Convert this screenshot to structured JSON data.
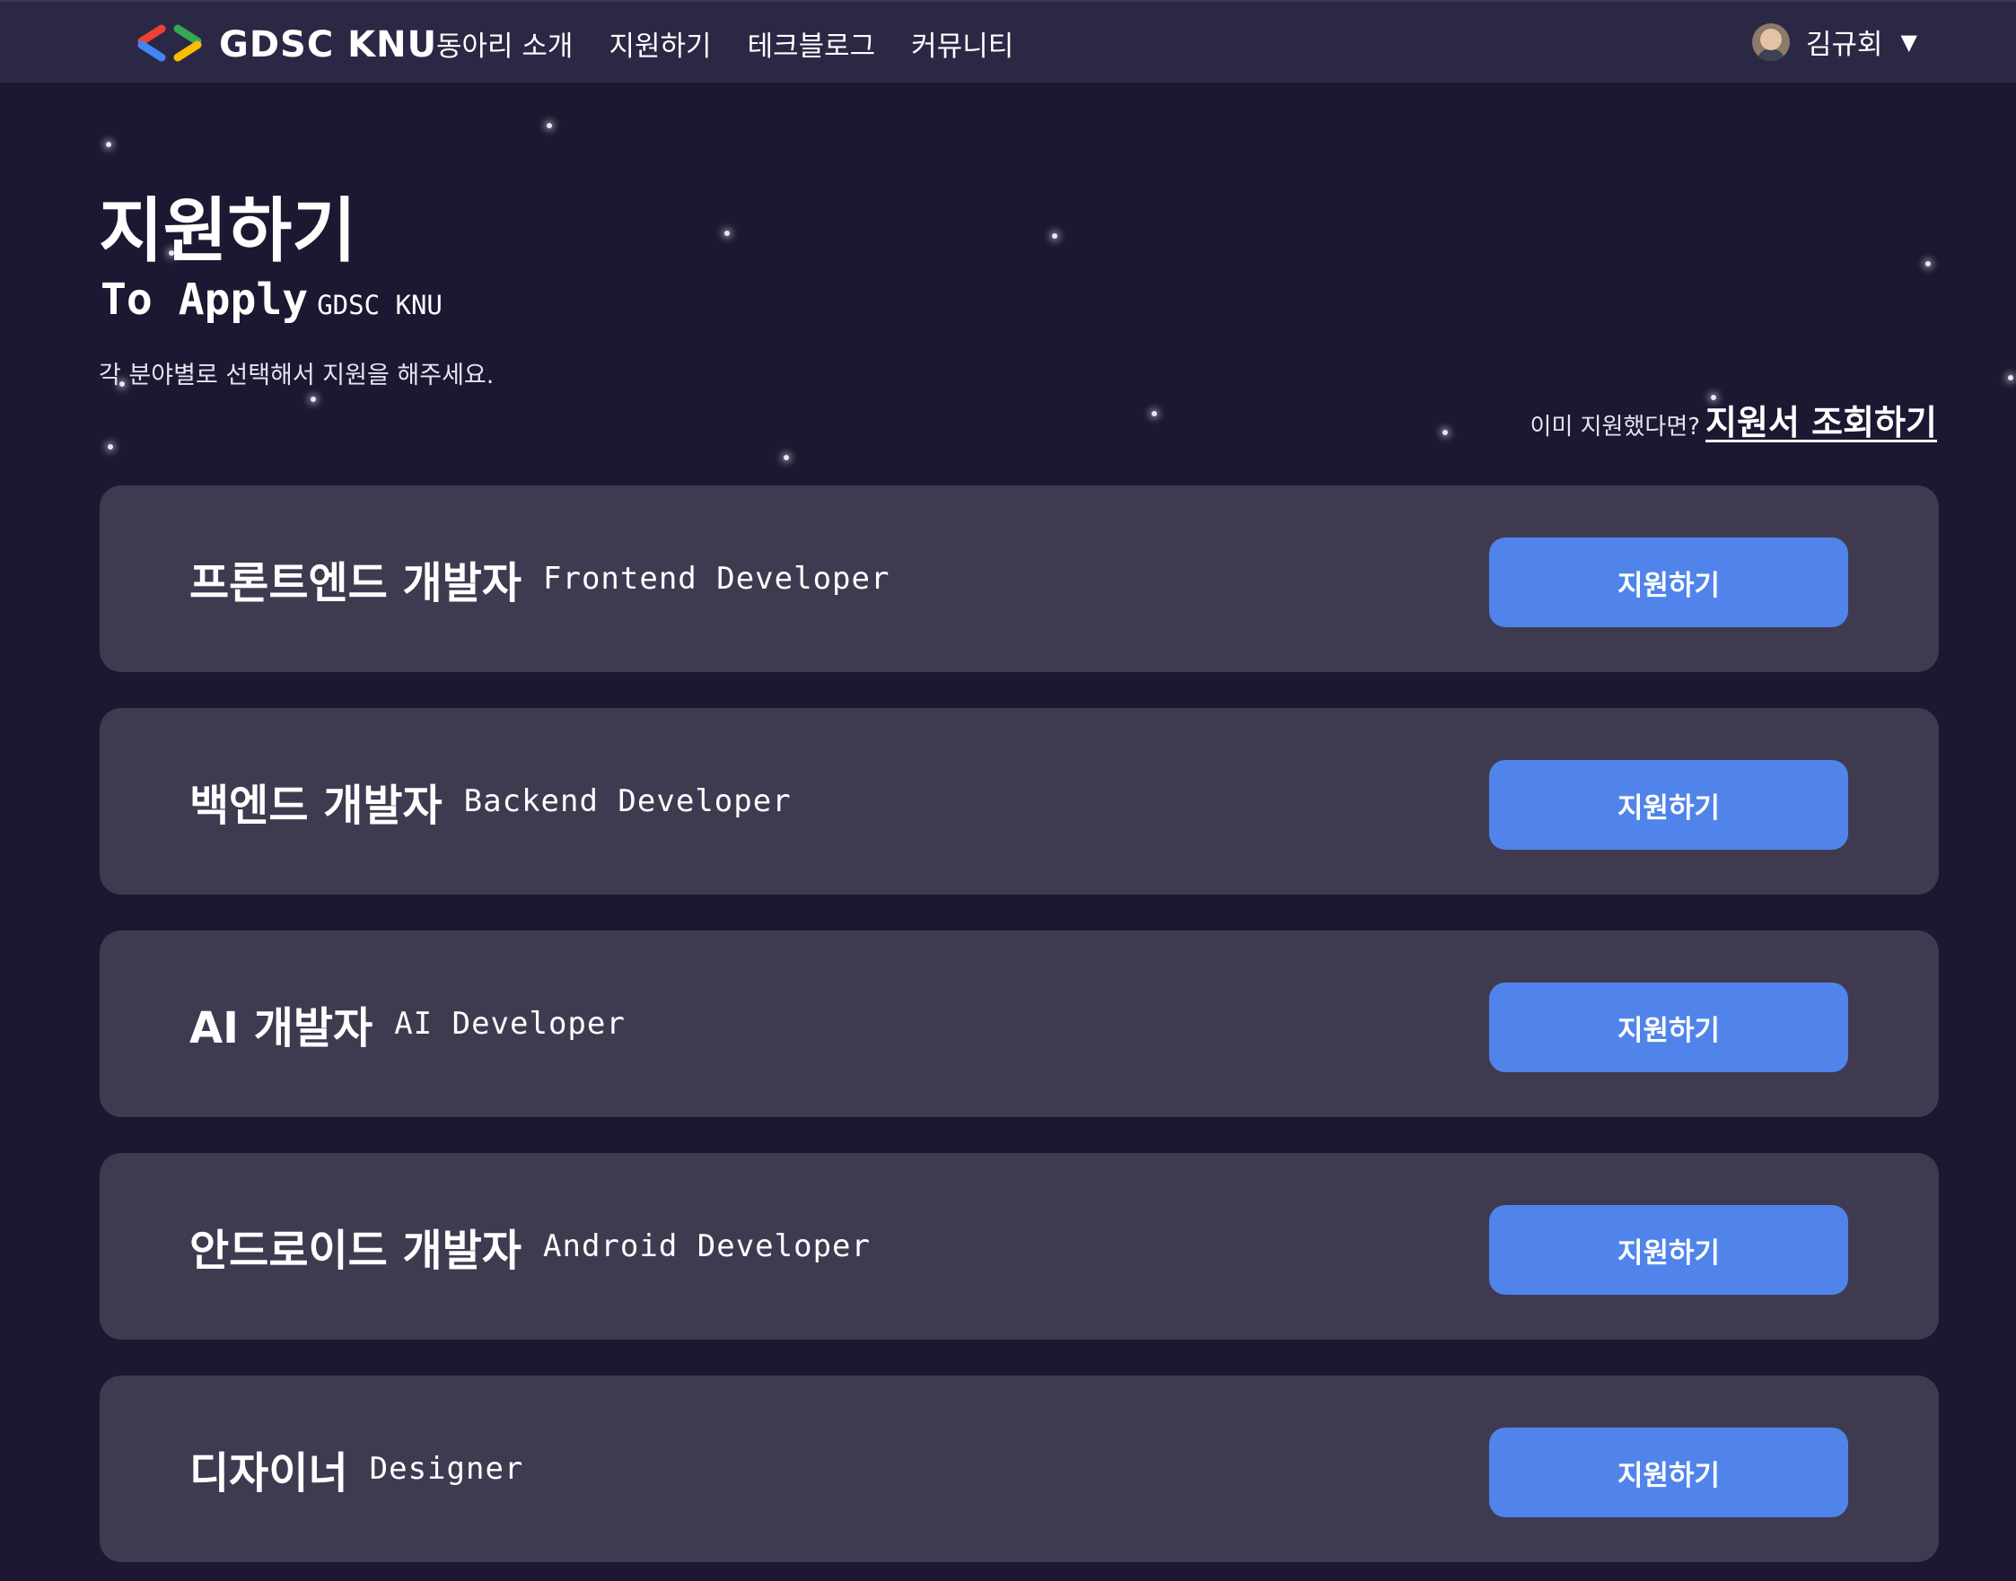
{
  "nav": {
    "brand": "GDSC KNU",
    "links": [
      "동아리 소개",
      "지원하기",
      "테크블로그",
      "커뮤니티"
    ],
    "user_name": "김규회",
    "caret": "▼"
  },
  "header": {
    "title": "지원하기",
    "subtitle": "To Apply",
    "subtitle_small": "GDSC KNU",
    "description": "각 분야별로 선택해서 지원을 해주세요.",
    "check_prompt": "이미 지원했다면?",
    "check_link": "지원서 조회하기"
  },
  "positions": [
    {
      "ko": "프론트엔드 개발자",
      "en": "Frontend Developer",
      "button": "지원하기"
    },
    {
      "ko": "백엔드 개발자",
      "en": "Backend Developer",
      "button": "지원하기"
    },
    {
      "ko": "AI 개발자",
      "en": "AI Developer",
      "button": "지원하기"
    },
    {
      "ko": "안드로이드 개발자",
      "en": "Android Developer",
      "button": "지원하기"
    },
    {
      "ko": "디자이너",
      "en": "Designer",
      "button": "지원하기"
    }
  ],
  "colors": {
    "background": "#1e1731",
    "navbar": "#2b2846",
    "card": "#403a51",
    "button": "#5084ea",
    "logo_red": "#ea4335",
    "logo_blue": "#4285f4",
    "logo_green": "#34a853",
    "logo_yellow": "#fbbc04"
  }
}
